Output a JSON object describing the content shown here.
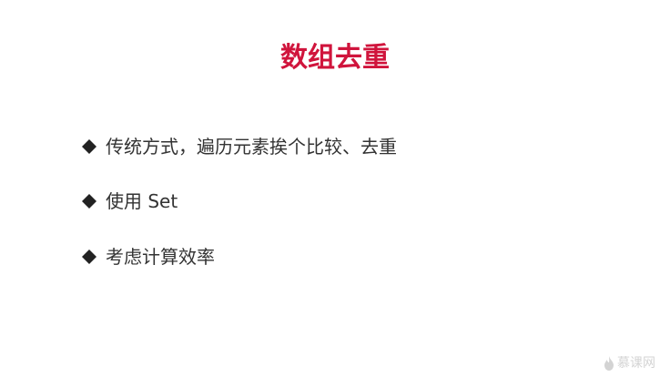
{
  "slide": {
    "title": "数组去重",
    "title_color": "#d0143c",
    "bullets": [
      {
        "text": "传统方式，遍历元素挨个比较、去重",
        "icon": "diamond-bullet-icon"
      },
      {
        "text": "使用 Set",
        "icon": "diamond-bullet-icon"
      },
      {
        "text": "考虑计算效率",
        "icon": "diamond-bullet-icon"
      }
    ],
    "bullet_color": "#333333"
  },
  "watermark": {
    "text": "慕课网",
    "icon": "flame-logo-icon"
  }
}
